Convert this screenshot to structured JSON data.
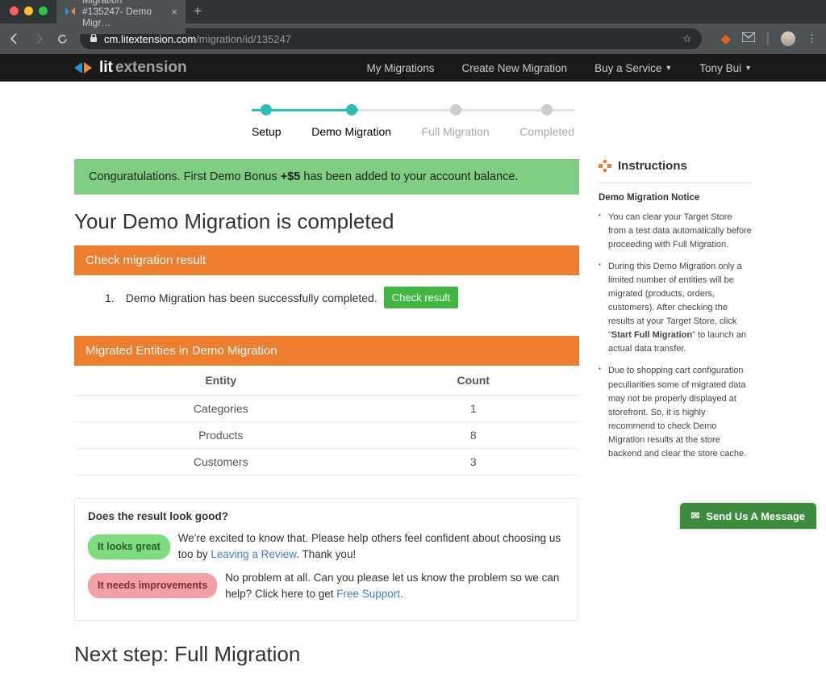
{
  "browser": {
    "tab_title": "Migration #135247- Demo Migr…",
    "url_host": "cm.litextension.com",
    "url_path": "/migration/id/135247"
  },
  "header": {
    "logo_lit": "lit",
    "logo_ext": "extension",
    "nav": {
      "my_migrations": "My Migrations",
      "create_new": "Create New Migration",
      "buy_service": "Buy a Service",
      "user": "Tony Bui"
    }
  },
  "stepper": {
    "steps": [
      {
        "label": "Setup",
        "state": "done"
      },
      {
        "label": "Demo Migration",
        "state": "done"
      },
      {
        "label": "Full Migration",
        "state": "pending"
      },
      {
        "label": "Completed",
        "state": "pending"
      }
    ]
  },
  "alert": {
    "prefix": "Conguratulations. First Demo Bonus ",
    "bonus": "+$5",
    "suffix": " has been added to your account balance."
  },
  "page_heading": "Your Demo Migration is completed",
  "sections": {
    "check_result": {
      "title": "Check migration result",
      "item_num": "1.",
      "item_text": "Demo Migration has been successfully completed.",
      "button": "Check result"
    },
    "entities": {
      "title": "Migrated Entities in Demo Migration",
      "th_entity": "Entity",
      "th_count": "Count",
      "rows": [
        {
          "name": "Categories",
          "count": "1"
        },
        {
          "name": "Products",
          "count": "8"
        },
        {
          "name": "Customers",
          "count": "3"
        }
      ]
    }
  },
  "feedback": {
    "title": "Does the result look good?",
    "good_btn": "It looks great",
    "good_text_a": "We're excited to know that. Please help others feel confident about choosing us too by ",
    "good_link": "Leaving a Review",
    "good_text_b": ". Thank you!",
    "bad_btn": "It needs improvements",
    "bad_text_a": "No problem at all. Can you please let us know the problem so we can help? Click here to get ",
    "bad_link": "Free Support",
    "bad_text_b": "."
  },
  "next_heading": "Next step: Full Migration",
  "instructions": {
    "title": "Instructions",
    "subtitle": "Demo Migration Notice",
    "items": [
      "You can clear your Target Store from a test data automatically before proceeding with Full Migration.",
      "During this Demo Migration only a limited number of entities will be migrated (products, orders, customers). After checking the results at your Target Store, click \"<b>Start Full Migration</b>\" to launch an actual data transfer.",
      "Due to shopping cart configuration peculiarities some of migrated data may not be properly displayed at storefront. So, it is highly recommend to check Demo Migration results at the store backend and clear the store cache."
    ]
  },
  "chat": {
    "label": "Send Us A Message"
  }
}
